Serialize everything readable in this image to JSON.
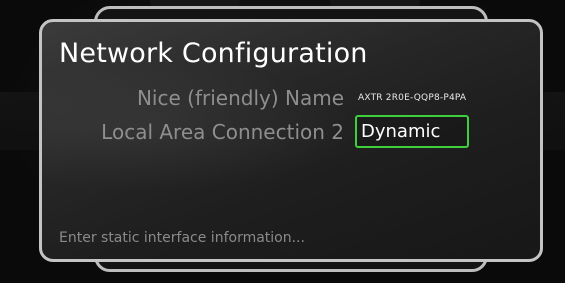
{
  "dialog": {
    "title": "Network Configuration",
    "fields": [
      {
        "label": "Nice (friendly) Name",
        "value": "AXTR 2R0E-QQP8-P4PA"
      },
      {
        "label": "Local Area Connection 2",
        "value": "Dynamic"
      }
    ],
    "hint": "Enter static interface information..."
  },
  "colors": {
    "focus_border": "#3fcf3a",
    "frame_border": "#c4c4c4",
    "label_text": "#8e8e8e",
    "title_text": "#ffffff"
  }
}
